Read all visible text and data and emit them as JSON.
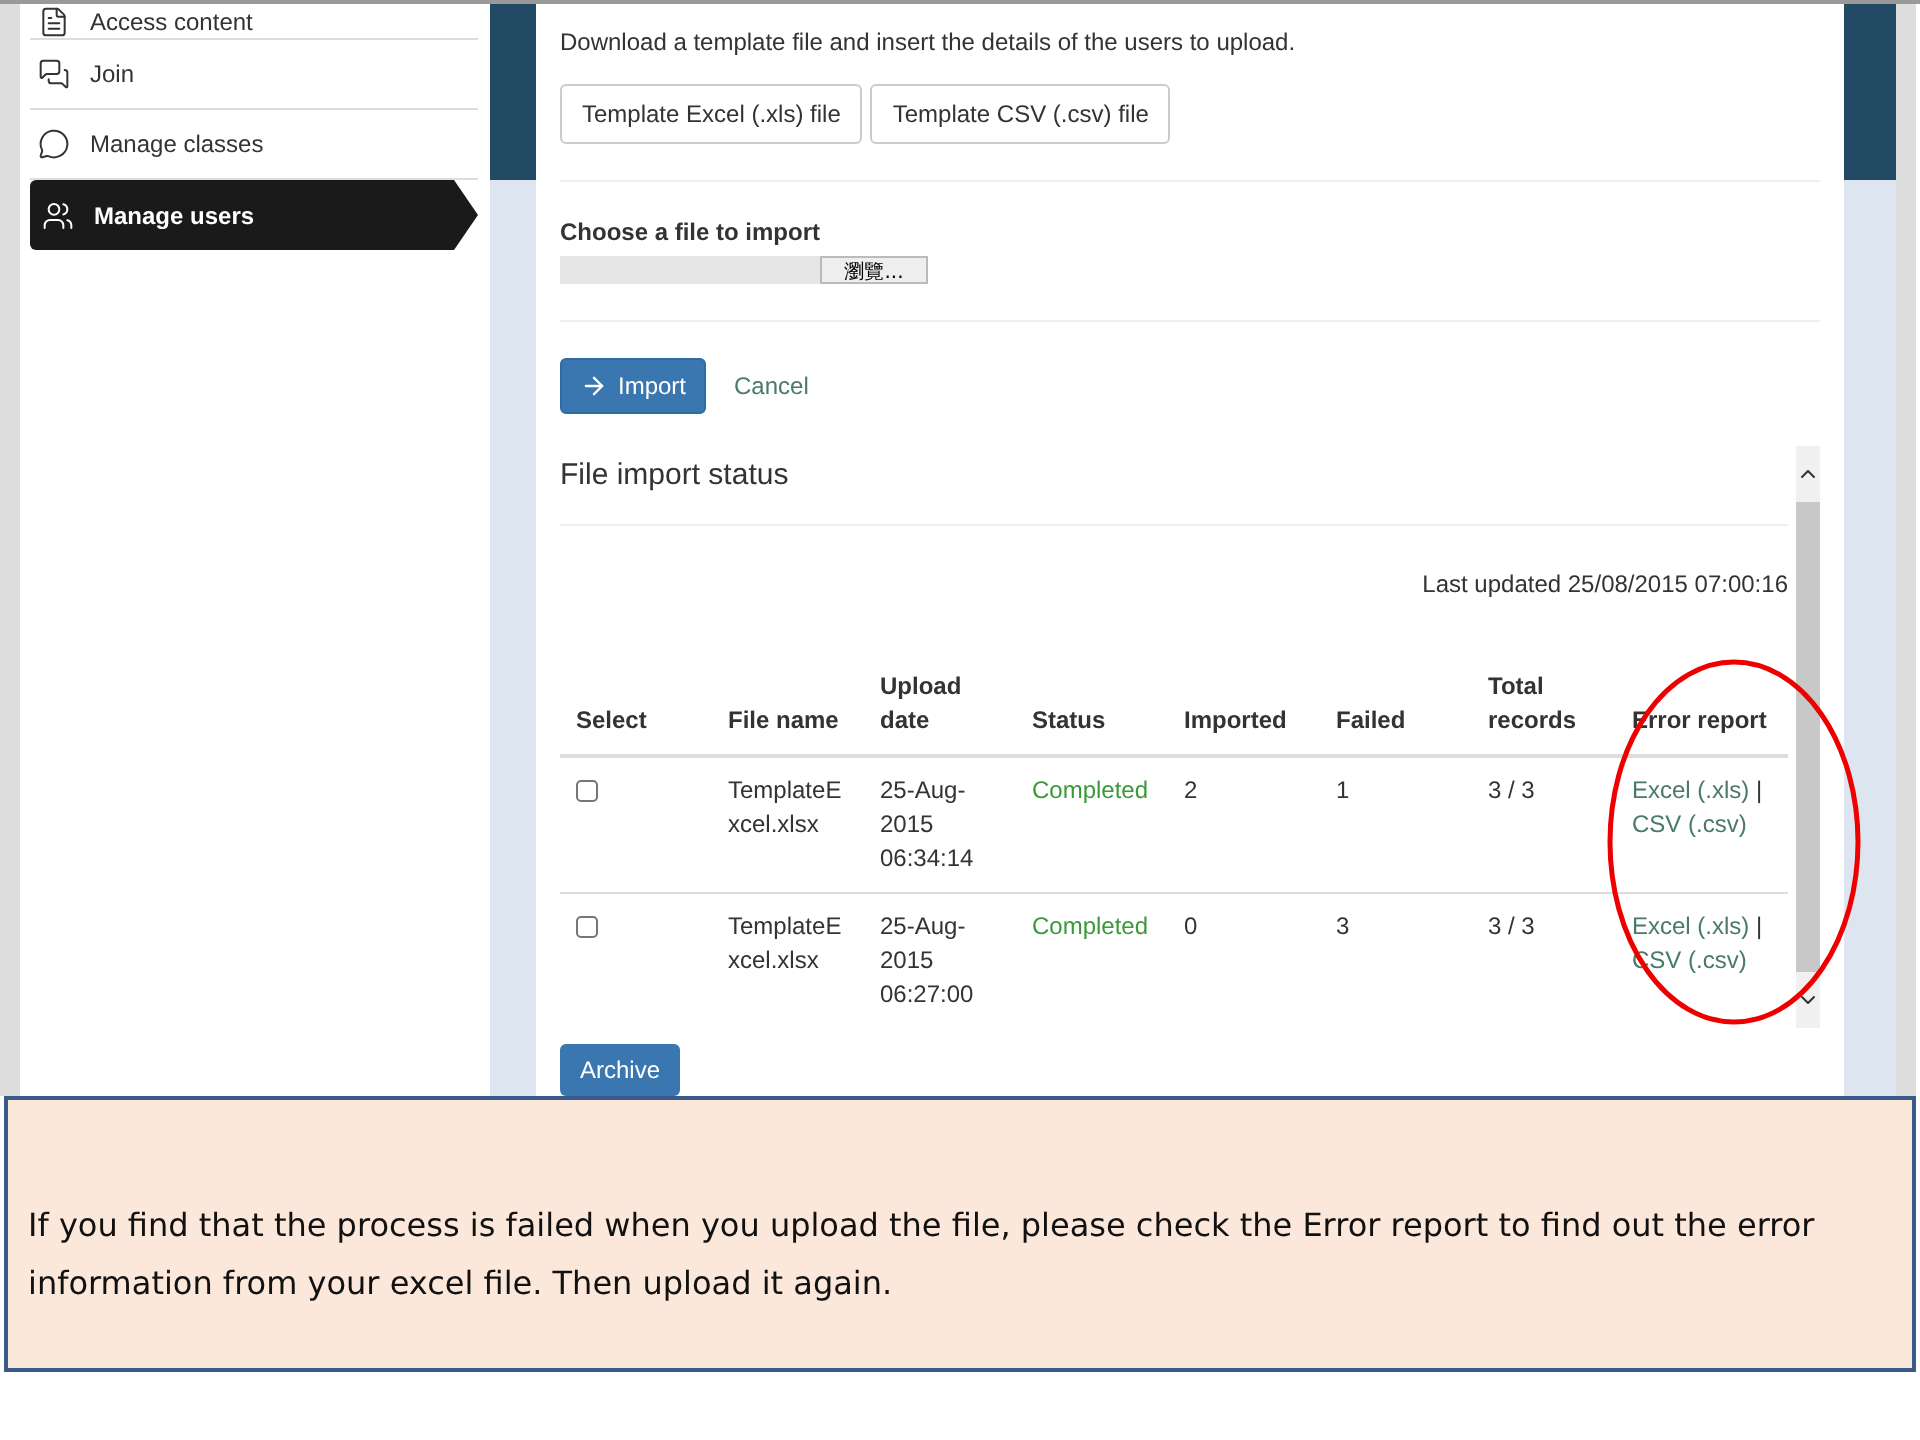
{
  "sidebar": {
    "items": [
      {
        "label": "Access content",
        "selected": false
      },
      {
        "label": "Join",
        "selected": false
      },
      {
        "label": "Manage classes",
        "selected": false
      },
      {
        "label": "Manage users",
        "selected": true
      }
    ]
  },
  "instructions": "Download a template file and insert the details of the users to upload.",
  "template_buttons": [
    "Template Excel (.xls) file",
    "Template CSV (.csv) file"
  ],
  "file_chooser": {
    "label": "Choose a file to import",
    "browse": "瀏覽..."
  },
  "actions": {
    "import": "Import",
    "cancel": "Cancel"
  },
  "status": {
    "title": "File import status",
    "last_updated": "Last updated 25/08/2015 07:00:16",
    "columns": [
      "Select",
      "File name",
      "Upload date",
      "Status",
      "Imported",
      "Failed",
      "Total records",
      "Error report"
    ],
    "rows": [
      {
        "checked": false,
        "file_name": "TemplateExcel.xlsx",
        "date": "25-Aug-2015",
        "time": "06:34:14",
        "status": "Completed",
        "imported": "2",
        "failed": "1",
        "total": "3 / 3",
        "links": [
          "Excel (.xls)",
          "CSV (.csv)"
        ],
        "separator": "|"
      },
      {
        "checked": false,
        "file_name": "TemplateExcel.xlsx",
        "date": "25-Aug-2015",
        "time": "06:27:00",
        "status": "Completed",
        "imported": "0",
        "failed": "3",
        "total": "3 / 3",
        "links": [
          "Excel (.xls)",
          "CSV (.csv)"
        ],
        "separator": "|"
      }
    ],
    "archive": "Archive"
  },
  "note": "If you find that the process is failed when you upload the file, please check the Error report to find out the error information from your excel file. Then upload it again."
}
